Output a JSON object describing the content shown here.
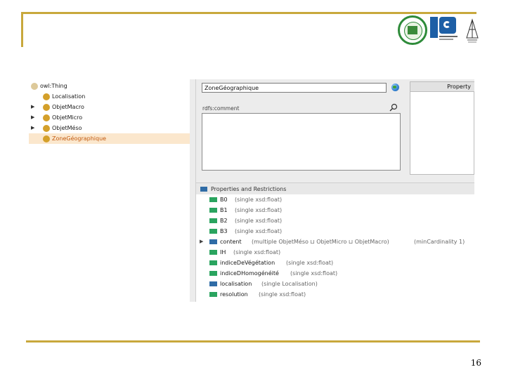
{
  "page_number": "16",
  "ontology_tree": {
    "root": "owl:Thing",
    "items": [
      {
        "label": "Localisation",
        "has_children": false,
        "selected": false
      },
      {
        "label": "ObjetMacro",
        "has_children": true,
        "selected": false
      },
      {
        "label": "ObjetMicro",
        "has_children": true,
        "selected": false
      },
      {
        "label": "ObjetMéso",
        "has_children": true,
        "selected": false
      },
      {
        "label": "ZoneGéographique",
        "has_children": false,
        "selected": true
      }
    ]
  },
  "class_editor": {
    "name_value": "ZoneGéographique",
    "comment_label": "rdfs:comment",
    "comment_value": "",
    "property_header": "Property"
  },
  "properties_section": {
    "title": "Properties and Restrictions",
    "rows": [
      {
        "name": "B0",
        "type": "(single xsd:float)",
        "kind": "datatype",
        "expandable": false,
        "extra": ""
      },
      {
        "name": "B1",
        "type": "(single xsd:float)",
        "kind": "datatype",
        "expandable": false,
        "extra": ""
      },
      {
        "name": "B2",
        "type": "(single xsd:float)",
        "kind": "datatype",
        "expandable": false,
        "extra": ""
      },
      {
        "name": "B3",
        "type": "(single xsd:float)",
        "kind": "datatype",
        "expandable": false,
        "extra": ""
      },
      {
        "name": "content",
        "type": "(multiple ObjetMéso ⊔ ObjetMicro ⊔ ObjetMacro)",
        "kind": "object",
        "expandable": true,
        "extra": "(minCardinality 1)"
      },
      {
        "name": "IH",
        "type": "(single xsd:float)",
        "kind": "datatype",
        "expandable": false,
        "extra": ""
      },
      {
        "name": "indiceDeVégétation",
        "type": "(single xsd:float)",
        "kind": "datatype",
        "expandable": false,
        "extra": ""
      },
      {
        "name": "indiceDHomogénéité",
        "type": "(single xsd:float)",
        "kind": "datatype",
        "expandable": false,
        "extra": ""
      },
      {
        "name": "localisation",
        "type": "(single Localisation)",
        "kind": "object",
        "expandable": false,
        "extra": ""
      },
      {
        "name": "resolution",
        "type": "(single xsd:float)",
        "kind": "datatype",
        "expandable": false,
        "extra": ""
      }
    ]
  },
  "colors": {
    "slide_accent": "#c8a83c",
    "class_icon": "#d4a02a",
    "selected_row": "#fbe7cd",
    "datatype_icon": "#2aa45f",
    "object_icon": "#2f6ca6"
  },
  "icons": {
    "class": "class-icon",
    "globe": "globe-icon",
    "search": "search-icon",
    "datatype_property": "datatype-property-icon",
    "object_property": "object-property-icon",
    "expand": "expand-arrow-icon"
  }
}
